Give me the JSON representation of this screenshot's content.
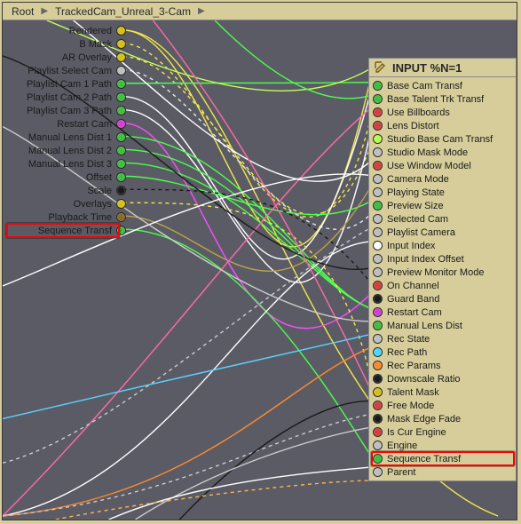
{
  "breadcrumb": {
    "root": "Root",
    "item": "TrackedCam_Unreal_3-Cam"
  },
  "left_node": {
    "ports": [
      {
        "label": "Rendered",
        "color": "#d6c018"
      },
      {
        "label": "B Mask",
        "color": "#d6c018"
      },
      {
        "label": "AR Overlay",
        "color": "#d6c018"
      },
      {
        "label": "Playlist Select Cam",
        "color": "#bfbfbf"
      },
      {
        "label": "Playlist Cam 1 Path",
        "color": "#3fbf3f"
      },
      {
        "label": "Playlist Cam 2 Path",
        "color": "#3fbf3f"
      },
      {
        "label": "Playlist Cam 3 Path",
        "color": "#3fbf3f"
      },
      {
        "label": "Restart Cam",
        "color": "#d63fd6"
      },
      {
        "label": "Manual Lens Dist 1",
        "color": "#3fbf3f"
      },
      {
        "label": "Manual Lens Dist 2",
        "color": "#3fbf3f"
      },
      {
        "label": "Manual Lens Dist 3",
        "color": "#3fbf3f"
      },
      {
        "label": "Offset",
        "color": "#3fbf3f"
      },
      {
        "label": "Scale",
        "color": "#1a1a1a"
      },
      {
        "label": "Overlays",
        "color": "#d6c018"
      },
      {
        "label": "Playback Time",
        "color": "#8a6a2a"
      },
      {
        "label": "Sequence Transf",
        "color": "#3fbf3f"
      }
    ]
  },
  "right_node": {
    "title": "INPUT %N=1",
    "ports": [
      {
        "label": "Base Cam Transf",
        "color": "#3fbf3f"
      },
      {
        "label": "Base Talent Trk Transf",
        "color": "#3fbf3f"
      },
      {
        "label": "Use Billboards",
        "color": "#d63f3f"
      },
      {
        "label": "Lens Distort",
        "color": "#d63f3f"
      },
      {
        "label": "Studio Base Cam Transf",
        "color": "#b6ff4a"
      },
      {
        "label": "Studio Mask Mode",
        "color": "#bfbfbf"
      },
      {
        "label": "Use Window Model",
        "color": "#d63f3f"
      },
      {
        "label": "Camera Mode",
        "color": "#bfbfbf"
      },
      {
        "label": "Playing State",
        "color": "#bfbfbf"
      },
      {
        "label": "Preview Size",
        "color": "#3fbf3f"
      },
      {
        "label": "Selected Cam",
        "color": "#bfbfbf"
      },
      {
        "label": "Playlist Camera",
        "color": "#bfbfbf"
      },
      {
        "label": "Input Index",
        "color": "#ffffff"
      },
      {
        "label": "Input Index Offset",
        "color": "#bfbfbf"
      },
      {
        "label": "Preview Monitor Mode",
        "color": "#bfbfbf"
      },
      {
        "label": "On Channel",
        "color": "#d63f3f"
      },
      {
        "label": "Guard Band",
        "color": "#1a1a1a"
      },
      {
        "label": "Restart Cam",
        "color": "#d63fd6"
      },
      {
        "label": "Manual Lens Dist",
        "color": "#3fbf3f"
      },
      {
        "label": "Rec State",
        "color": "#bfbfbf"
      },
      {
        "label": "Rec Path",
        "color": "#4ad6ff"
      },
      {
        "label": "Rec Params",
        "color": "#ff8a2a"
      },
      {
        "label": "Downscale Ratio",
        "color": "#1a1a1a"
      },
      {
        "label": "Talent Mask",
        "color": "#d6c018"
      },
      {
        "label": "Free Mode",
        "color": "#d63f3f"
      },
      {
        "label": "Mask Edge Fade",
        "color": "#1a1a1a"
      },
      {
        "label": "Is Cur Engine",
        "color": "#d63f3f"
      },
      {
        "label": "Engine",
        "color": "#bfbfbf"
      },
      {
        "label": "Sequence Transf",
        "color": "#3fbf3f"
      },
      {
        "label": "Parent",
        "color": "#bfbfbf"
      }
    ]
  },
  "highlights": {
    "left_label": "Sequence Transf",
    "right_label": "Sequence Transf"
  },
  "colors": {
    "bg_panel": "#d6cd9a",
    "bg_canvas": "#5b5b66"
  }
}
